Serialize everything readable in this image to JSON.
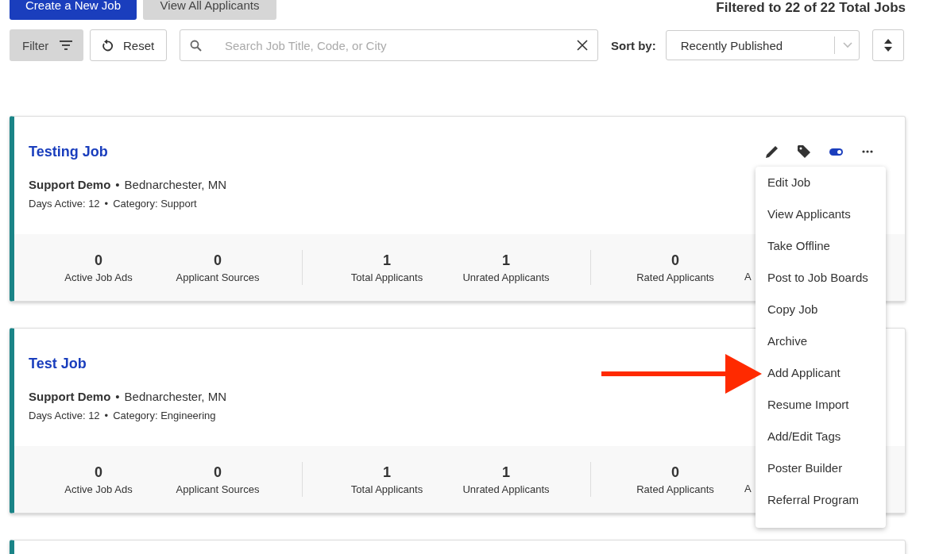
{
  "top_actions": [
    {
      "label": "Create a New Job",
      "kind": "primary"
    },
    {
      "label": "View All Applicants",
      "kind": "secondary"
    }
  ],
  "summary": "Filtered to 22 of 22 Total Jobs",
  "toolbar": {
    "filter_label": "Filter",
    "reset_label": "Reset",
    "search": {
      "placeholder": "Search Job Title, Code, or City"
    },
    "sort_label": "Sort by:",
    "sort_value": "Recently Published"
  },
  "jobs": [
    {
      "title": "Testing Job",
      "company": "Support Demo",
      "location": "Bednarchester, MN",
      "separator": "•",
      "days_active": "Days Active: 12",
      "separator_2": "•",
      "category": "Category: Support",
      "actions": {
        "online": true
      },
      "stat_groups": [
        [
          {
            "value": "0",
            "label": "Active Job Ads"
          },
          {
            "value": "0",
            "label": "Applicant Sources"
          }
        ],
        [
          {
            "value": "1",
            "label": "Total Applicants"
          },
          {
            "value": "1",
            "label": "Unrated Applicants"
          }
        ],
        [
          {
            "value": "0",
            "label": "Rated Applicants"
          },
          {
            "label": "A"
          }
        ]
      ]
    },
    {
      "title": "Test Job",
      "company": "Support Demo",
      "location": "Bednarchester, MN",
      "separator": "•",
      "days_active": "Days Active: 12",
      "separator_2": "•",
      "category": "Category: Engineering",
      "stat_groups": [
        [
          {
            "value": "0",
            "label": "Active Job Ads"
          },
          {
            "value": "0",
            "label": "Applicant Sources"
          }
        ],
        [
          {
            "value": "1",
            "label": "Total Applicants"
          },
          {
            "value": "1",
            "label": "Unrated Applicants"
          }
        ],
        [
          {
            "value": "0",
            "label": "Rated Applicants"
          },
          {
            "label": "A"
          }
        ]
      ]
    },
    {
      "kind": "cut"
    }
  ],
  "menu": {
    "items": [
      "Edit Job",
      "View Applicants",
      "Take Offline",
      "Post to Job Boards",
      "Copy Job",
      "Archive",
      "Add Applicant",
      "Resume Import",
      "Add/Edit Tags",
      "Poster Builder",
      "Referral Program"
    ]
  },
  "annotation": {
    "kind": "arrow"
  }
}
